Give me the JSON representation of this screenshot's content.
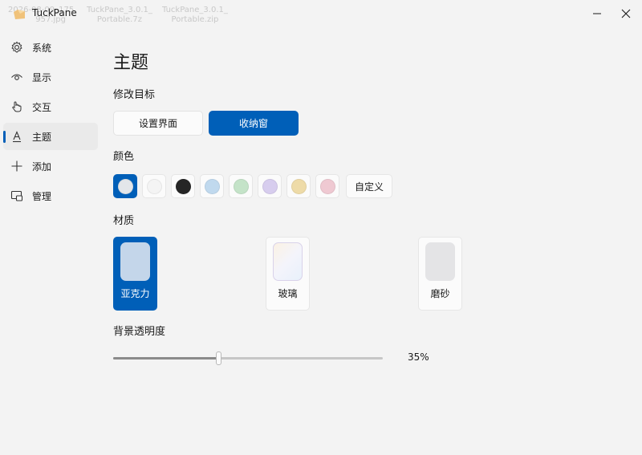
{
  "desktop_bg": {
    "files": [
      {
        "line1": "2026-08-09_175",
        "line2": "957.jpg"
      },
      {
        "line1": "TuckPane_3.0.1_",
        "line2": "Portable.7z"
      },
      {
        "line1": "TuckPane_3.0.1_",
        "line2": "Portable.zip"
      }
    ]
  },
  "window": {
    "title": "TuckPane"
  },
  "sidebar": {
    "items": [
      {
        "label": "系统",
        "icon": "gear-icon"
      },
      {
        "label": "显示",
        "icon": "eye-icon"
      },
      {
        "label": "交互",
        "icon": "hand-pointer-icon"
      },
      {
        "label": "主题",
        "icon": "letter-a-icon"
      },
      {
        "label": "添加",
        "icon": "plus-icon"
      },
      {
        "label": "管理",
        "icon": "manage-icon"
      }
    ],
    "active_index": 3
  },
  "main": {
    "title": "主题",
    "target": {
      "label": "修改目标",
      "options": [
        "设置界面",
        "收纳窗"
      ],
      "selected": 1
    },
    "color": {
      "label": "颜色",
      "swatches": [
        "#e3e6ea",
        "#f4f4f4",
        "#262626",
        "#c0d9ee",
        "#c4e3c8",
        "#d7cdee",
        "#eedba8",
        "#efc9d2"
      ],
      "selected": 0,
      "custom_label": "自定义"
    },
    "material": {
      "label": "材质",
      "options": [
        {
          "label": "亚克力",
          "icon": "acrylic-preview-icon"
        },
        {
          "label": "玻璃",
          "icon": "glass-preview-icon"
        },
        {
          "label": "磨砂",
          "icon": "frosted-preview-icon"
        }
      ],
      "selected": 0
    },
    "opacity": {
      "label": "背景透明度",
      "value_pct": 35,
      "value_text": "35%"
    }
  },
  "colors": {
    "accent": "#005fb8"
  }
}
